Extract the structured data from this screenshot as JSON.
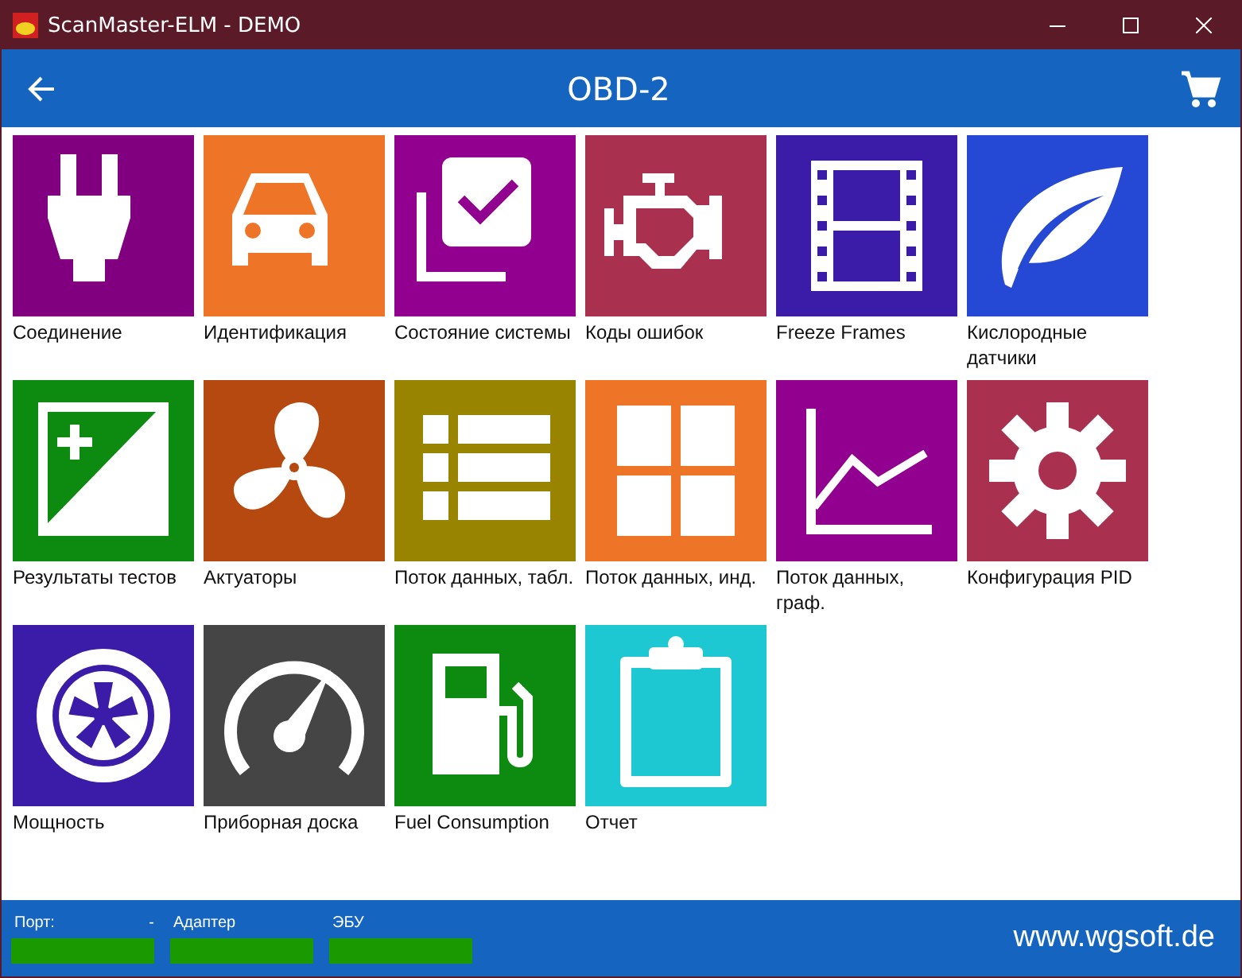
{
  "window": {
    "title": "ScanMaster-ELM - DEMO"
  },
  "header": {
    "title": "OBD-2"
  },
  "tiles": [
    {
      "label": "Соединение",
      "color": "#800080",
      "kind": "plug"
    },
    {
      "label": "Идентификация",
      "color": "#ee7428",
      "kind": "car"
    },
    {
      "label": "Состояние системы",
      "color": "#92008f",
      "kind": "check"
    },
    {
      "label": "Коды ошибок",
      "color": "#aa3050",
      "kind": "engine"
    },
    {
      "label": "Freeze Frames",
      "color": "#3b1ca8",
      "kind": "film"
    },
    {
      "label": "Кислородные датчики",
      "color": "#2549d4",
      "kind": "leaf"
    },
    {
      "label": "Результаты тестов",
      "color": "#0d8a10",
      "kind": "plusminus"
    },
    {
      "label": "Актуаторы",
      "color": "#b5490f",
      "kind": "fan"
    },
    {
      "label": "Поток данных, табл.",
      "color": "#998400",
      "kind": "list"
    },
    {
      "label": "Поток данных, инд.",
      "color": "#ee7428",
      "kind": "grid"
    },
    {
      "label": "Поток данных, граф.",
      "color": "#92008f",
      "kind": "chart"
    },
    {
      "label": "Конфигурация PID",
      "color": "#aa3050",
      "kind": "gear"
    },
    {
      "label": "Мощность",
      "color": "#3b1ca8",
      "kind": "wheel"
    },
    {
      "label": "Приборная доска",
      "color": "#454545",
      "kind": "gauge"
    },
    {
      "label": "Fuel Consumption",
      "color": "#0d8a10",
      "kind": "fuel"
    },
    {
      "label": "Отчет",
      "color": "#1ec8d2",
      "kind": "clipboard"
    }
  ],
  "status": [
    {
      "label": "Порт:",
      "value": "-",
      "color": "#1a9a00"
    },
    {
      "label": "Адаптер",
      "color": "#1a9a00"
    },
    {
      "label": "ЭБУ",
      "color": "#1a9a00"
    }
  ],
  "website": "www.wgsoft.de"
}
